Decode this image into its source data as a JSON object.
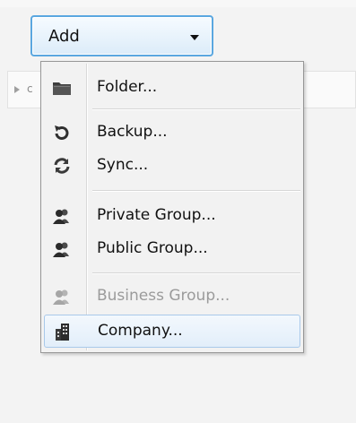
{
  "add_menu": {
    "button_label": "Add",
    "items": [
      {
        "label": "Folder...",
        "icon": "folder-icon",
        "disabled": false
      },
      {
        "label": "Backup...",
        "icon": "backup-icon",
        "disabled": false
      },
      {
        "label": "Sync...",
        "icon": "sync-icon",
        "disabled": false
      },
      {
        "label": "Private Group...",
        "icon": "private-group-icon",
        "disabled": false
      },
      {
        "label": "Public Group...",
        "icon": "public-group-icon",
        "disabled": false
      },
      {
        "label": "Business Group...",
        "icon": "business-group-icon",
        "disabled": true
      },
      {
        "label": "Company...",
        "icon": "company-icon",
        "disabled": false,
        "highlighted": true
      }
    ]
  },
  "colors": {
    "button_border": "#5aa7e0",
    "highlight_border": "#a9c9ea",
    "disabled_text": "#9b9b9b",
    "icon_dark": "#3a3a3a"
  }
}
